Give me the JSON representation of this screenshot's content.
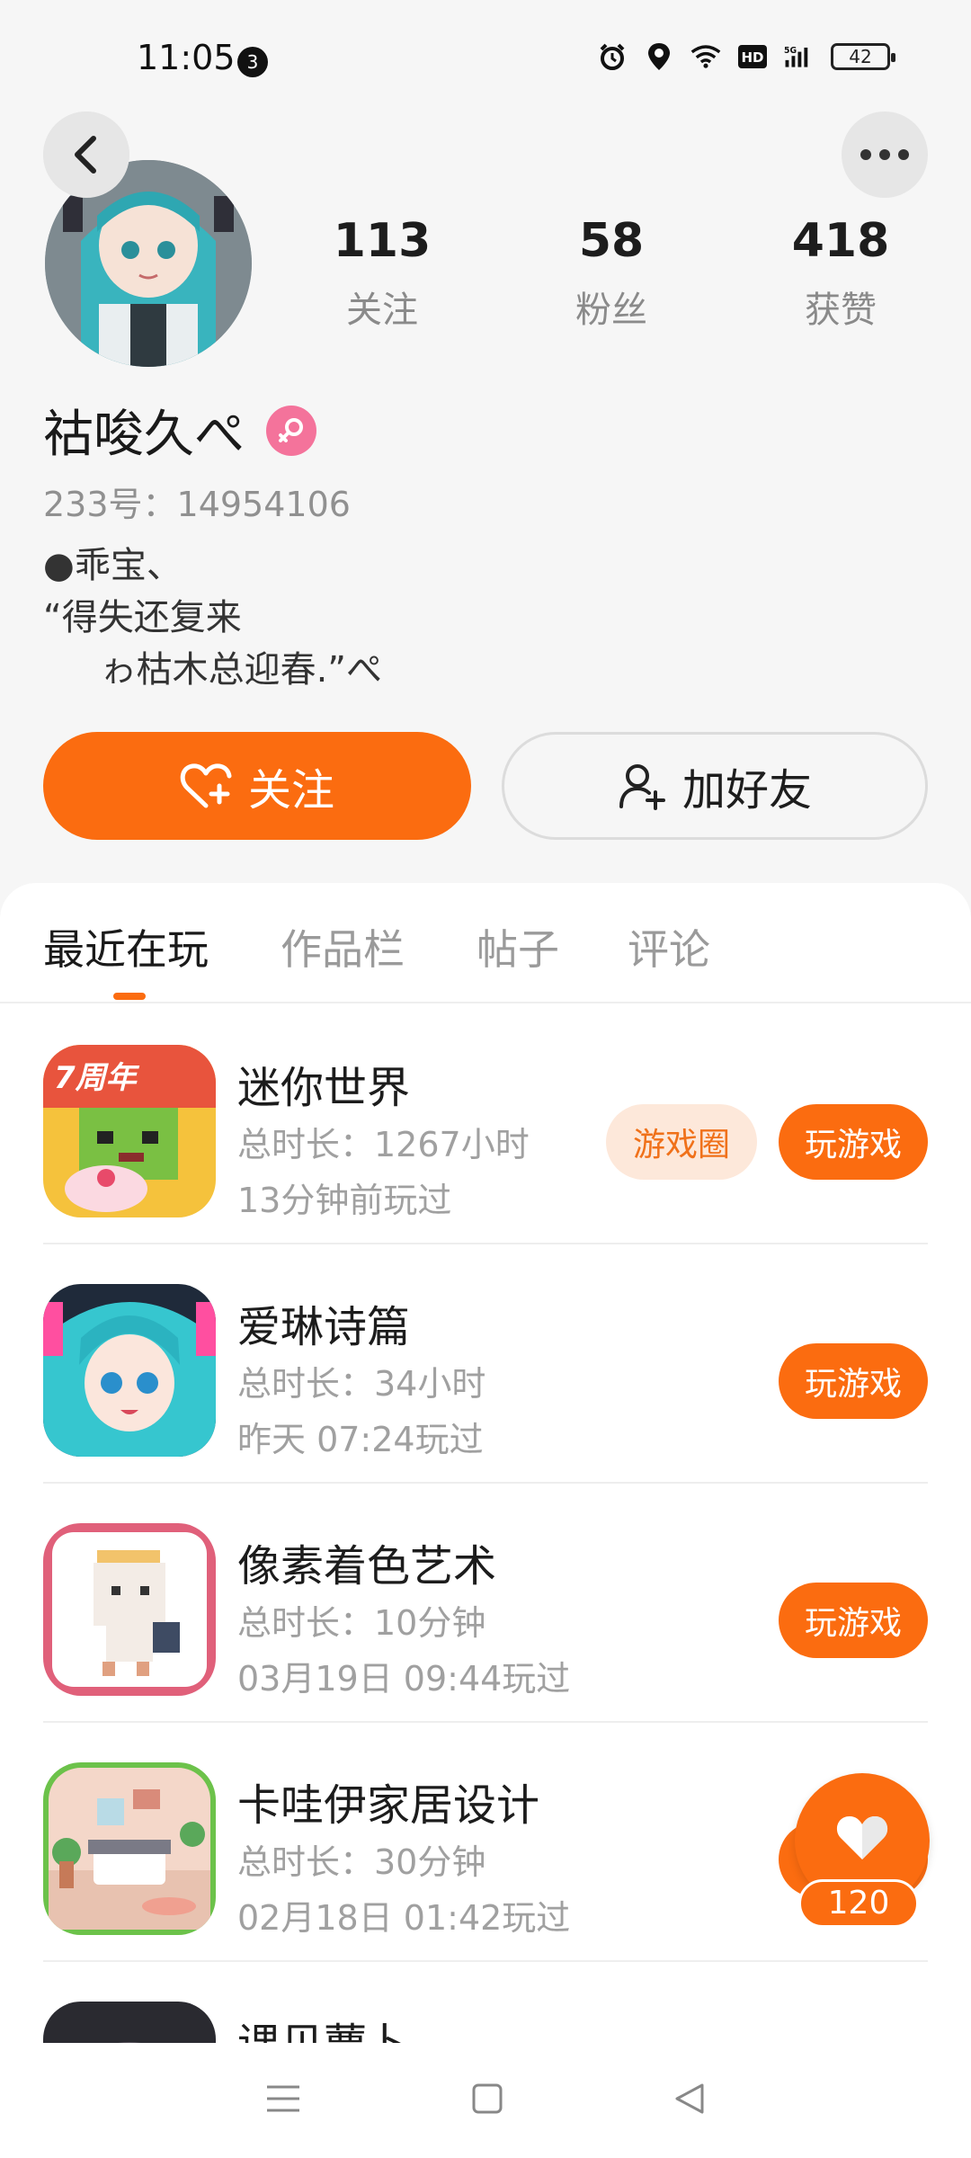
{
  "status_bar": {
    "time": "11:05",
    "notification_count": "3",
    "battery": "42",
    "network": "5G",
    "hd": "HD"
  },
  "profile": {
    "stats": [
      {
        "value": "113",
        "label": "关注"
      },
      {
        "value": "58",
        "label": "粉丝"
      },
      {
        "value": "418",
        "label": "获赞"
      }
    ],
    "username": "祜唆久ぺ",
    "gender": "female",
    "uid": "233号：14954106",
    "bio": "●乖宝、\n“得失还复来\n     ゎ枯木总迎春.”ぺ",
    "follow_label": "关注",
    "add_friend_label": "加好友"
  },
  "tabs": [
    {
      "label": "最近在玩",
      "active": true
    },
    {
      "label": "作品栏",
      "active": false
    },
    {
      "label": "帖子",
      "active": false
    },
    {
      "label": "评论",
      "active": false
    }
  ],
  "games": [
    {
      "title": "迷你世界",
      "duration": "总时长：1267小时",
      "last_played": "13分钟前玩过",
      "circle_label": "游戏圈",
      "play_label": "玩游戏"
    },
    {
      "title": "爱琳诗篇",
      "duration": "总时长：34小时",
      "last_played": "昨天 07:24玩过",
      "play_label": "玩游戏"
    },
    {
      "title": "像素着色艺术",
      "duration": "总时长：10分钟",
      "last_played": "03月19日 09:44玩过",
      "play_label": "玩游戏"
    },
    {
      "title": "卡哇伊家居设计",
      "duration": "总时长：30分钟",
      "last_played": "02月18日 01:42玩过",
      "play_label": "玩游戏"
    },
    {
      "title": "课贝蕈卜",
      "duration": "",
      "last_played": "",
      "play_label": ""
    }
  ],
  "like_fab": {
    "count": "120"
  },
  "colors": {
    "accent": "#fb6c10",
    "background": "#f6f6f6"
  }
}
